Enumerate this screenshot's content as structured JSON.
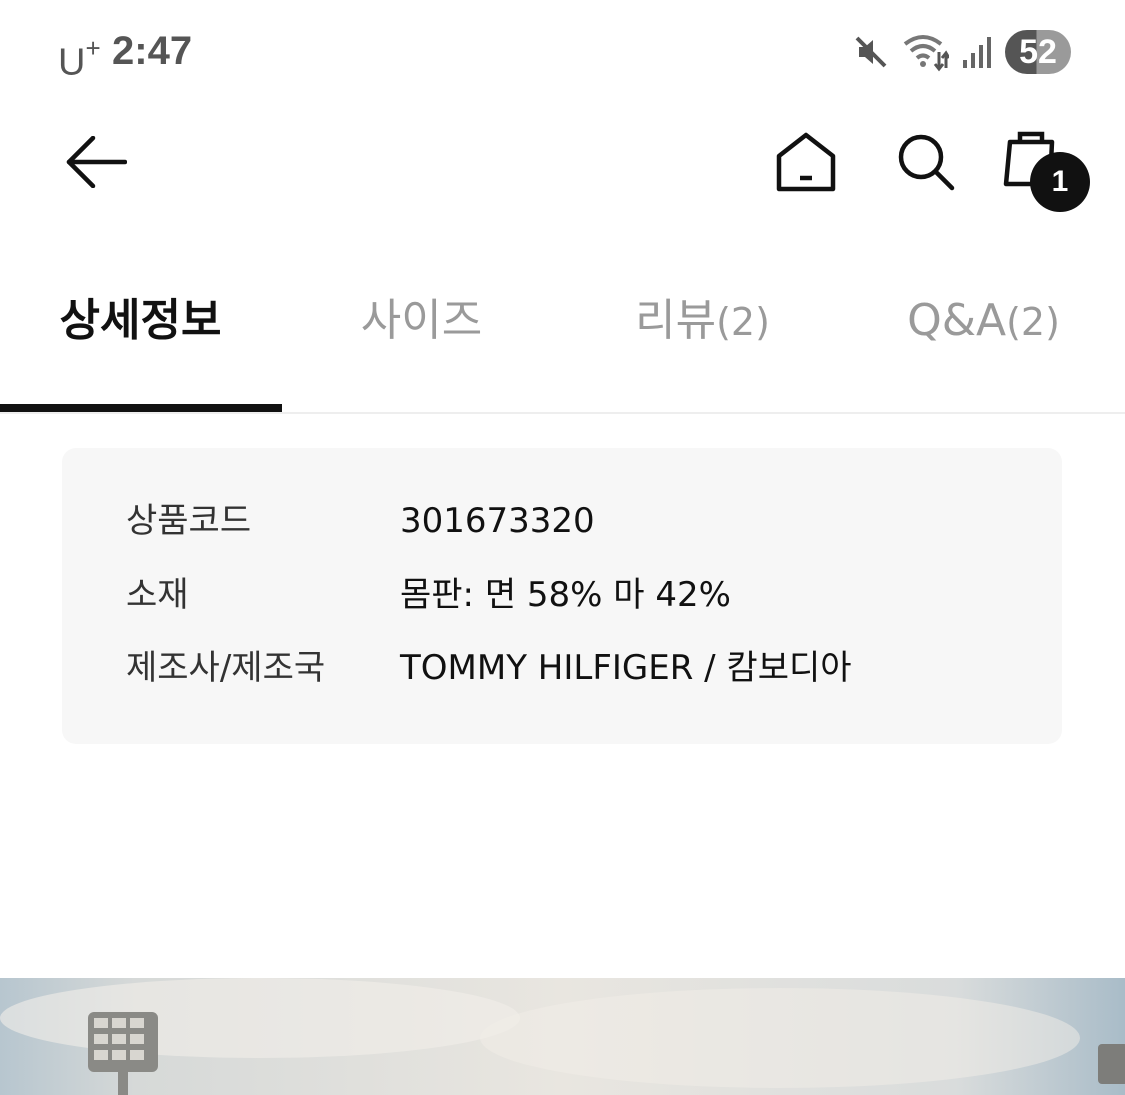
{
  "status_bar": {
    "carrier": "U",
    "carrier_sup": "+",
    "time": "2:47",
    "battery": "52",
    "icons": [
      "mute-icon",
      "wifi-icon",
      "signal-icon",
      "battery-icon"
    ]
  },
  "header": {
    "icons": [
      "back-arrow-icon",
      "home-icon",
      "search-icon",
      "shopping-bag-icon"
    ],
    "cart_count": "1"
  },
  "tabs": [
    {
      "label": "상세정보",
      "count": "",
      "active": true
    },
    {
      "label": "사이즈",
      "count": "",
      "active": false
    },
    {
      "label": "리뷰",
      "count": "(2)",
      "active": false
    },
    {
      "label": "Q&A",
      "count": "(2)",
      "active": false
    }
  ],
  "product_info": {
    "rows": [
      {
        "label": "상품코드",
        "value": "301673320"
      },
      {
        "label": "소재",
        "value": "몸판: 면 58% 마 42%"
      },
      {
        "label": "제조사/제조국",
        "value": "TOMMY HILFIGER / 캄보디아"
      }
    ]
  },
  "colors": {
    "text_primary": "#111111",
    "text_inactive": "#9a9a9a",
    "card_background": "#f7f7f7",
    "badge_background": "#111111"
  }
}
